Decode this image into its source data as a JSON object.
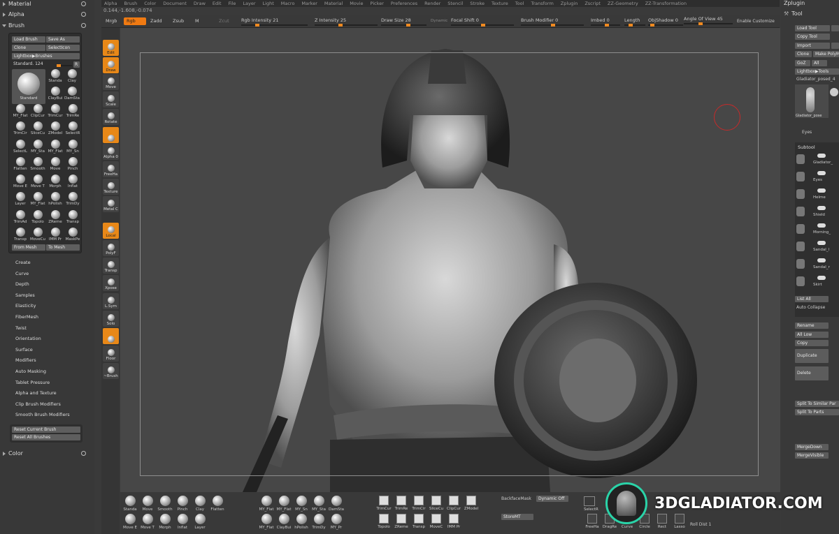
{
  "menu": [
    "Alpha",
    "Brush",
    "Color",
    "Document",
    "Draw",
    "Edit",
    "File",
    "Layer",
    "Light",
    "Macro",
    "Marker",
    "Material",
    "Movie",
    "Picker",
    "Preferences",
    "Render",
    "Stencil",
    "Stroke",
    "Texture",
    "Tool",
    "Transform",
    "Zplugin",
    "Zscript",
    "ZZ-Geometry",
    "ZZ-Transformation"
  ],
  "coords": "0.144,-1.608,-0.074",
  "toolbar": {
    "mrgb": "Mrgb",
    "rgb": "Rgb",
    "zadd": "Zadd",
    "zsub": "Zsub",
    "m": "M",
    "zcut": "Zcut",
    "rgb_intensity": "Rgb Intensity 21",
    "z_intensity": "Z Intensity 25",
    "draw_size": "Draw Size 28",
    "dynamic": "Dynamic",
    "focal_shift": "Focal Shift 0",
    "brush_modifier": "Brush Modifier 0",
    "imbed": "Imbed 0",
    "length": "Length",
    "objshadow": "ObjShadow 0",
    "angle_of_view": "Angle Of View 45",
    "enable_customize": "Enable Customize"
  },
  "left": {
    "material": "Material",
    "alpha": "Alpha",
    "brush": "Brush",
    "load_brush": "Load Brush",
    "save_as": "Save As",
    "clone": "Clone",
    "select_icon": "SelectIcon",
    "lightbox": "Lightbox▶Brushes",
    "standard": "Standard. 124",
    "r": "R",
    "big_brush": "Standard",
    "top_small": [
      "Standa",
      "Clay",
      "ClayBui",
      "DamSta"
    ],
    "grid": [
      "MY_Flat",
      "ClipCur",
      "TrimCur",
      "TrimRe",
      "TrimCir",
      "SliceCu",
      "ZModel",
      "SelectR",
      "SelectL",
      "MY_Sta",
      "MY_Flat",
      "MY_Sn",
      "Flatten",
      "Smooth",
      "Move",
      "Pinch",
      "Move E",
      "Move T",
      "Morph",
      "Inflat",
      "Layer",
      "MY_Flat",
      "hPolish",
      "TrimDy",
      "TrimAd",
      "Topolo",
      "ZReme",
      "Transp",
      "Transp",
      "MoveCu",
      "IMM Pr",
      "MaskPe"
    ],
    "from_mesh": "From Mesh",
    "to_mesh": "To Mesh",
    "subpalettes": [
      "Create",
      "Curve",
      "Depth",
      "Samples",
      "Elasticity",
      "FiberMesh",
      "Twist",
      "Orientation",
      "Surface",
      "Modifiers",
      "Auto Masking",
      "Tablet Pressure",
      "Alpha and Texture",
      "Clip Brush Modifiers",
      "Smooth Brush Modifiers"
    ],
    "reset_current": "Reset Current Brush",
    "reset_all": "Reset All Brushes",
    "color": "Color"
  },
  "shelf": [
    "Edit",
    "Draw",
    "Move",
    "Scale",
    "Rotate",
    "",
    "Alpha 0",
    "FreeHa",
    "Texture",
    "Metal C",
    "Local",
    "PolyF",
    "Transp",
    "Xpose",
    "L.Sym",
    "Solo",
    "",
    "Floor",
    "~Brush"
  ],
  "bottom": {
    "row1": [
      "Standa",
      "Move",
      "Smooth",
      "Pinch",
      "Clay",
      "Flatten"
    ],
    "row2": [
      "Move E",
      "Move T",
      "Morph",
      "Inflat",
      "Layer"
    ],
    "row1b": [
      "MY_Flat",
      "MY_Flat",
      "MY_Sn",
      "MY_Sta",
      "DamSta"
    ],
    "row2b": [
      "MY_Flat",
      "ClayBui",
      "hPolish",
      "TrimDy",
      "MY_Pr"
    ],
    "row1c": [
      "TrimCur",
      "TrimRe",
      "TrimCir",
      "SliceCu",
      "ClipCur",
      "ZModel"
    ],
    "row2c": [
      "Topolo",
      "ZReme",
      "Transp",
      "MoveC",
      "IMM Pr"
    ],
    "backface": "BackfaceMask",
    "dynamic_off": "Dynamic Off",
    "storemt": "StoreMT",
    "selectr": "SelectR",
    "tools": [
      "FreeHa",
      "DragRe",
      "Curve",
      "Circle",
      "Rect",
      "Lasso"
    ],
    "roll_dist": "Roll Dist 1"
  },
  "right": {
    "zplugin": "Zplugin",
    "tool": "Tool",
    "load_tool": "Load Tool",
    "copy_tool": "Copy Tool",
    "import": "Import",
    "clone": "Clone",
    "make_poly": "Make PolyM",
    "goz": "GoZ",
    "all": "All",
    "lightbox_tools": "Lightbox▶Tools",
    "tool_name": "Gladiator_posed_4",
    "thumb_label": "Gladiator_pose",
    "eyes": "Eyes",
    "subtool": "Subtool",
    "subtools": [
      "Gladiator_",
      "Eyes",
      "Helme",
      "Shield",
      "Morning_",
      "Sandal_l",
      "Sandal_r",
      "Skirt"
    ],
    "list_all": "List All",
    "auto_collapse": "Auto Collapse",
    "rename": "Rename",
    "all_low": "All Low",
    "copy": "Copy",
    "duplicate": "Duplicate",
    "delete": "Delete",
    "split_to_similar": "Split To Similar Par",
    "split_to_parts": "Split To Parts",
    "merge_down": "MergeDown",
    "merge_visible": "MergeVisible"
  },
  "watermark": "3DGLADIATOR.COM",
  "colors": {
    "accent": "#f07a12",
    "cursor": "#c62a2a",
    "logo_ring": "#2ad3a8"
  }
}
